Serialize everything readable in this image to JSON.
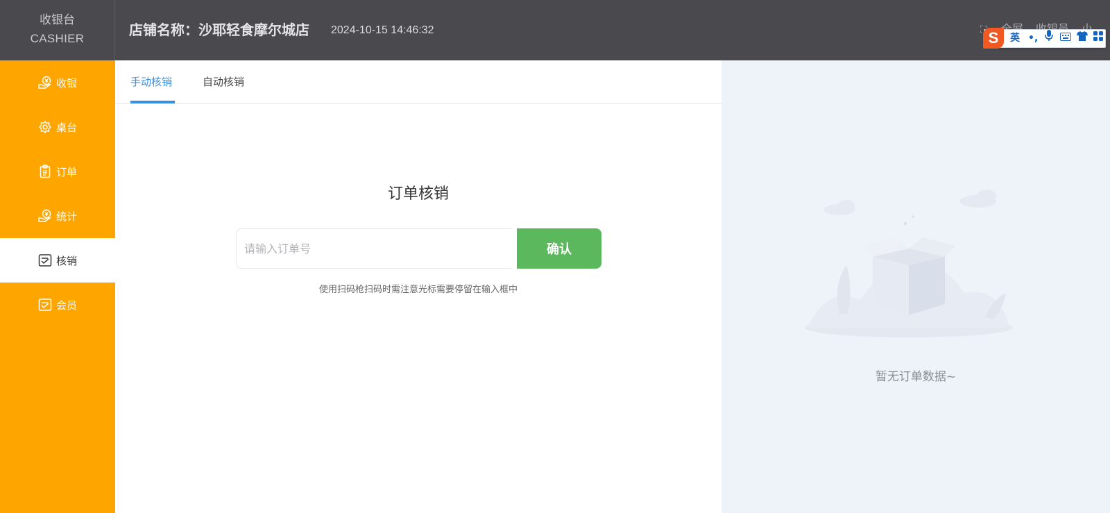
{
  "app": {
    "brand_cn": "收银台",
    "brand_en": "CASHIER",
    "store_name": "店铺名称：沙耶轻食摩尔城店",
    "datetime": "2024-10-15 14:46:32",
    "header_right": {
      "fullscreen_label": "全屏",
      "cashier_label": "收银员",
      "user_label": "小"
    }
  },
  "ime": {
    "logo": "S",
    "mode": "英",
    "items": [
      "punctuation-icon",
      "microphone-icon",
      "keyboard-icon",
      "skin-icon",
      "toolbox-icon"
    ]
  },
  "sidebar": {
    "items": [
      {
        "label": "收银",
        "icon": "cash-icon",
        "active": false
      },
      {
        "label": "桌台",
        "icon": "gear-icon",
        "active": false
      },
      {
        "label": "订单",
        "icon": "clipboard-icon",
        "active": false
      },
      {
        "label": "统计",
        "icon": "stats-icon",
        "active": false
      },
      {
        "label": "核销",
        "icon": "verify-icon",
        "active": true
      },
      {
        "label": "会员",
        "icon": "member-icon",
        "active": false
      }
    ]
  },
  "main": {
    "tabs": [
      {
        "label": "手动核销",
        "active": true
      },
      {
        "label": "自动核销",
        "active": false
      }
    ],
    "form_title": "订单核销",
    "order_input": {
      "value": "",
      "placeholder": "请输入订单号"
    },
    "confirm_label": "确认",
    "hint": "使用扫码枪扫码时需注意光标需要停留在输入框中"
  },
  "right_panel": {
    "empty_text": "暂无订单数据~"
  },
  "colors": {
    "header_bg": "#4a4a4e",
    "sidebar_bg": "#ffa500",
    "accent_blue": "#3a8fe0",
    "confirm_green": "#5cb85c",
    "right_bg": "#eef2f9"
  }
}
